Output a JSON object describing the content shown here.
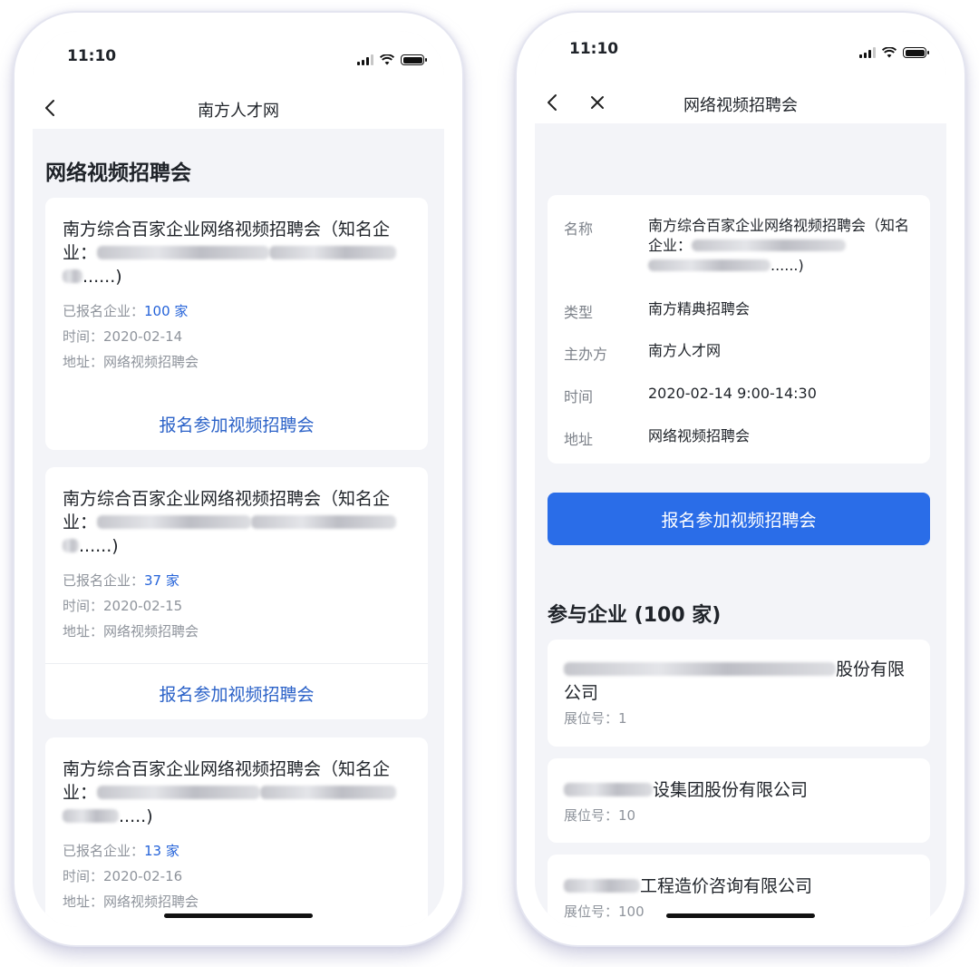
{
  "status_time": "11:10",
  "left": {
    "nav_title": "南方人才网",
    "section_title": "网络视频招聘会",
    "cards": [
      {
        "title_prefix": "南方综合百家企业网络视频招聘会（知名企业：",
        "title_suffix": "......)",
        "registered_label": "已报名企业：",
        "registered_count": "100 家",
        "time": "时间：2020-02-14",
        "address": "地址：网络视频招聘会",
        "action": "报名参加视频招聘会"
      },
      {
        "title_prefix": "南方综合百家企业网络视频招聘会（知名企业：",
        "title_suffix": "......)",
        "registered_label": "已报名企业：",
        "registered_count": "37 家",
        "time": "时间：2020-02-15",
        "address": "地址：网络视频招聘会",
        "action": "报名参加视频招聘会"
      },
      {
        "title_prefix": "南方综合百家企业网络视频招聘会（知名企业：",
        "title_suffix": ".....)",
        "registered_label": "已报名企业：",
        "registered_count": "13 家",
        "time": "时间：2020-02-16",
        "address": "地址：网络视频招聘会"
      }
    ]
  },
  "right": {
    "nav_title": "网络视频招聘会",
    "info": {
      "name_label": "名称",
      "name_prefix": "南方综合百家企业网络视频招聘会（知名企业：",
      "name_suffix": "......)",
      "type_label": "类型",
      "type_value": "南方精典招聘会",
      "organizer_label": "主办方",
      "organizer_value": "南方人才网",
      "time_label": "时间",
      "time_value": "2020-02-14 9:00-14:30",
      "address_label": "地址",
      "address_value": "网络视频招聘会"
    },
    "register_button": "报名参加视频招聘会",
    "companies_title": "参与企业 (100 家)",
    "companies": [
      {
        "name_suffix": "股份有限公司",
        "booth": "展位号：1"
      },
      {
        "name_suffix": "设集团股份有限公司",
        "booth": "展位号：10"
      },
      {
        "name_suffix": "工程造价咨询有限公司",
        "booth": "展位号：100"
      }
    ]
  },
  "icons": [
    "back-icon",
    "close-icon",
    "signal-icon",
    "wifi-icon",
    "battery-icon"
  ]
}
